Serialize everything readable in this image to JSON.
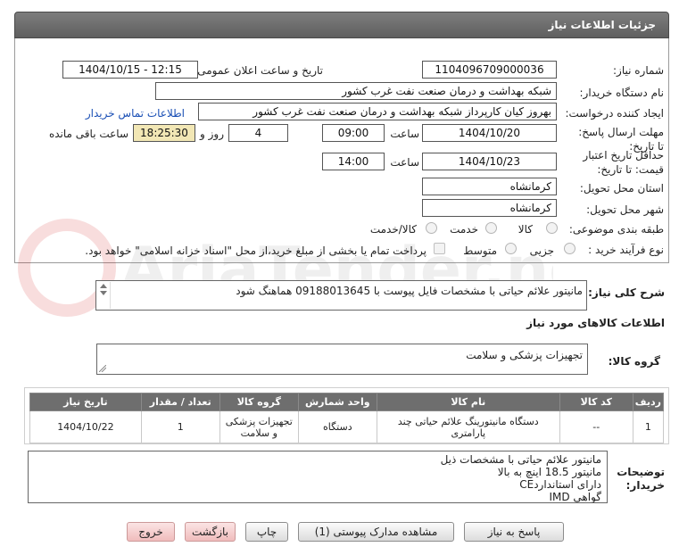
{
  "header": {
    "title": "جزئیات اطلاعات نیاز"
  },
  "fields": {
    "need_number_label": "شماره نیاز:",
    "need_number": "1104096709000036",
    "announce_label": "تاریخ و ساعت اعلان عمومی:",
    "announce_value": "1404/10/15 - 12:15",
    "buyer_org_label": "نام دستگاه خریدار:",
    "buyer_org": "شبکه بهداشت و درمان صنعت نفت غرب کشور",
    "creator_label": "ایجاد کننده درخواست:",
    "creator": "بهروز کیان کارپرداز شبکه بهداشت و درمان صنعت نفت غرب کشور",
    "contact_link": "اطلاعات تماس خریدار",
    "deadline_label": "مهلت ارسال پاسخ: تا تاریخ:",
    "deadline_date": "1404/10/20",
    "time_label": "ساعت",
    "deadline_time": "09:00",
    "days": "4",
    "days_label": "روز و",
    "remaining": "18:25:30",
    "remaining_label": "ساعت باقی مانده",
    "validity_label": "حداقل تاریخ اعتبار قیمت: تا تاریخ:",
    "validity_date": "1404/10/23",
    "validity_time": "14:00",
    "province_label": "استان محل تحویل:",
    "province": "کرمانشاه",
    "city_label": "شهر محل تحویل:",
    "city": "کرمانشاه",
    "category_label": "طبقه بندی موضوعی:",
    "category_options": [
      "کالا",
      "خدمت",
      "کالا/خدمت"
    ],
    "process_label": "نوع فرآیند خرید :",
    "process_options": [
      "جزیی",
      "متوسط"
    ],
    "payment_note": "پرداخت تمام یا بخشی از مبلغ خرید،از محل \"اسناد خزانه اسلامی\" خواهد بود."
  },
  "summary": {
    "label": "شرح کلی نیاز:",
    "text": "مانیتور علائم حیاتی با مشخصات فایل پیوست با 09188013645 هماهنگ شود"
  },
  "goods": {
    "section_title": "اطلاعات کالاهای مورد نیاز",
    "group_label": "گروه کالا:",
    "group_value": "تجهیزات پزشکی و سلامت"
  },
  "table": {
    "headers": [
      "ردیف",
      "کد کالا",
      "نام کالا",
      "واحد شمارش",
      "گروه کالا",
      "تعداد / مقدار",
      "تاریخ نیاز"
    ],
    "rows": [
      [
        "1",
        "--",
        "دستگاه مانیتورینگ علائم حیاتی چند پارامتری",
        "دستگاه",
        "تجهیزات پزشکی و سلامت",
        "1",
        "1404/10/22"
      ]
    ]
  },
  "buyer_notes": {
    "label": "توضیحات خریدار:",
    "lines": [
      "مانیتور علائم حیاتی با مشخصات ذیل",
      "مانیتور 18.5 اینچ به بالا",
      "دارای استانداردCE",
      "گواهی IMD"
    ]
  },
  "buttons": {
    "reply": "پاسخ به نیاز",
    "view_docs": "مشاهده مدارک پیوستی (1)",
    "print": "چاپ",
    "back": "بازگشت",
    "exit": "خروج"
  },
  "watermark": "AriaTender.net",
  "colors": {
    "header_bg": "#6a6a6a",
    "remaining_bg": "#f2e7b5",
    "link": "#1a4fb5",
    "pink_button": "#f0bcbc"
  }
}
